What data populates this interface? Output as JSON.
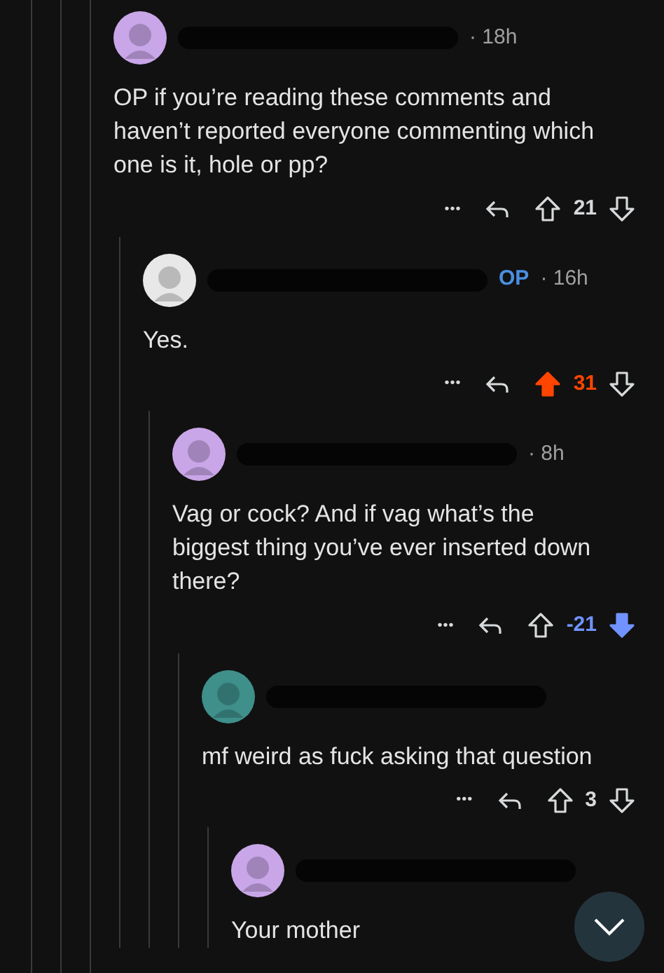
{
  "comments": [
    {
      "color": "#c9a6e8",
      "time": "· 18h",
      "body": "OP if you’re reading these comments and haven’t reported everyone commenting which one is it, hole or pp?",
      "more": "•••",
      "votes": {
        "count": "21",
        "upvoted": false,
        "downvoted": false
      },
      "children": [
        {
          "color": "#e8e8e8",
          "badge": "OP",
          "time": "· 16h",
          "body": "Yes.",
          "more": "•••",
          "votes": {
            "count": "31",
            "upvoted": true,
            "downvoted": false
          },
          "children": [
            {
              "color": "#c9a6e8",
              "time": "· 8h",
              "body": "Vag or cock? And if vag what’s the biggest thing you’ve ever inserted down there?",
              "more": "•••",
              "votes": {
                "count": "-21",
                "upvoted": false,
                "downvoted": true
              },
              "children": [
                {
                  "color": "#3f8f8a",
                  "body": "mf weird as fuck asking that question",
                  "more": "•••",
                  "votes": {
                    "count": "3",
                    "upvoted": false,
                    "downvoted": false
                  },
                  "children": [
                    {
                      "color": "#c9a6e8",
                      "body": "Your mother"
                    }
                  ]
                }
              ]
            }
          ]
        }
      ]
    }
  ]
}
